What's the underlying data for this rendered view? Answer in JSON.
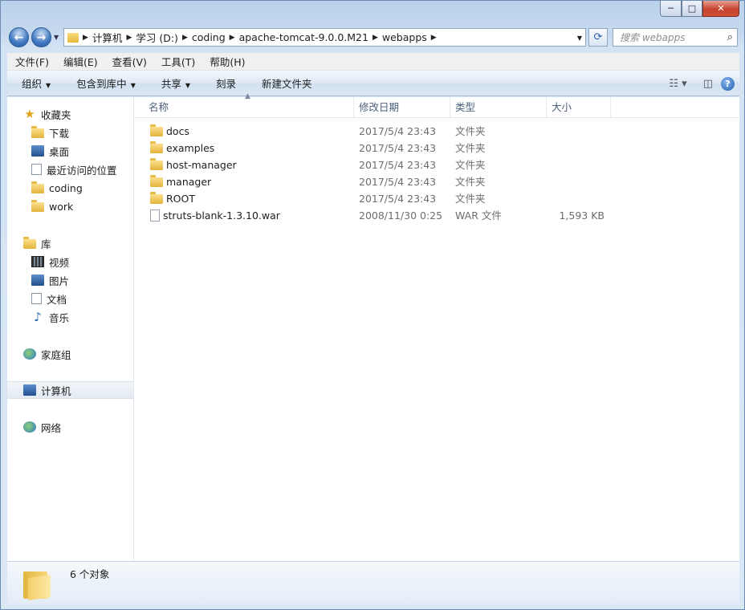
{
  "window": {
    "min_label": "─",
    "max_label": "□",
    "close_label": "✕"
  },
  "nav_buttons": {
    "back": "←",
    "forward": "→"
  },
  "address": {
    "crumbs": [
      "计算机",
      "学习 (D:)",
      "coding",
      "apache-tomcat-9.0.0.M21",
      "webapps"
    ]
  },
  "search": {
    "placeholder": "搜索 webapps"
  },
  "menu": [
    "文件(F)",
    "编辑(E)",
    "查看(V)",
    "工具(T)",
    "帮助(H)"
  ],
  "commands": {
    "organize": "组织",
    "include_library": "包含到库中",
    "share": "共享",
    "burn": "刻录",
    "new_folder": "新建文件夹",
    "help": "?"
  },
  "sidebar": {
    "favorites": "收藏夹",
    "downloads": "下载",
    "desktop": "桌面",
    "recent": "最近访问的位置",
    "coding": "coding",
    "work": "work",
    "libraries": "库",
    "videos": "视频",
    "pictures": "图片",
    "documents": "文档",
    "music": "音乐",
    "homegroup": "家庭组",
    "computer": "计算机",
    "network": "网络"
  },
  "columns": {
    "name": "名称",
    "date": "修改日期",
    "type": "类型",
    "size": "大小"
  },
  "files": [
    {
      "name": "docs",
      "date": "2017/5/4 23:43",
      "type": "文件夹",
      "size": ""
    },
    {
      "name": "examples",
      "date": "2017/5/4 23:43",
      "type": "文件夹",
      "size": ""
    },
    {
      "name": "host-manager",
      "date": "2017/5/4 23:43",
      "type": "文件夹",
      "size": ""
    },
    {
      "name": "manager",
      "date": "2017/5/4 23:43",
      "type": "文件夹",
      "size": ""
    },
    {
      "name": "ROOT",
      "date": "2017/5/4 23:43",
      "type": "文件夹",
      "size": ""
    },
    {
      "name": "struts-blank-1.3.10.war",
      "date": "2008/11/30 0:25",
      "type": "WAR 文件",
      "size": "1,593 KB"
    }
  ],
  "status": {
    "count": "6 个对象"
  }
}
